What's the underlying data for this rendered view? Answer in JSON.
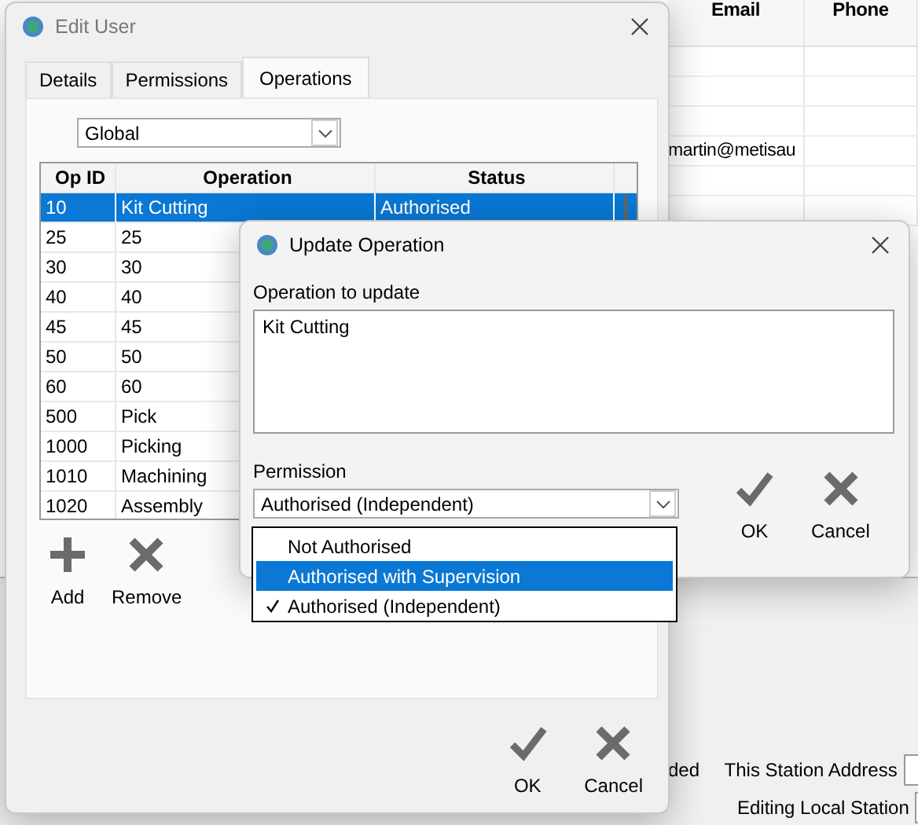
{
  "background_app": {
    "table": {
      "columns": [
        "Email",
        "Phone"
      ],
      "rows": [
        {
          "email": ""
        },
        {
          "email": ""
        },
        {
          "email": ""
        },
        {
          "email": "martin@metisau"
        },
        {
          "email": ""
        },
        {
          "email": ""
        }
      ]
    },
    "footer": {
      "status_fragment": "ded",
      "fields": [
        {
          "label": "This Station Address"
        },
        {
          "label": "Editing Local Station"
        }
      ]
    }
  },
  "edit_user": {
    "title": "Edit User",
    "tabs": [
      {
        "label": "Details",
        "selected": false
      },
      {
        "label": "Permissions",
        "selected": false
      },
      {
        "label": "Operations",
        "selected": true
      }
    ],
    "scope": "Global",
    "table": {
      "columns": [
        "Op ID",
        "Operation",
        "Status"
      ],
      "rows": [
        {
          "op_id": "10",
          "operation": "Kit Cutting",
          "status": "Authorised",
          "selected": true
        },
        {
          "op_id": "25",
          "operation": "25",
          "selected": false
        },
        {
          "op_id": "30",
          "operation": "30",
          "selected": false
        },
        {
          "op_id": "40",
          "operation": "40",
          "selected": false
        },
        {
          "op_id": "45",
          "operation": "45",
          "selected": false
        },
        {
          "op_id": "50",
          "operation": "50",
          "selected": false
        },
        {
          "op_id": "60",
          "operation": "60",
          "selected": false
        },
        {
          "op_id": "500",
          "operation": "Pick",
          "selected": false
        },
        {
          "op_id": "1000",
          "operation": "Picking",
          "selected": false
        },
        {
          "op_id": "1010",
          "operation": "Machining",
          "selected": false
        },
        {
          "op_id": "1020",
          "operation": "Assembly",
          "selected": false
        }
      ]
    },
    "list_buttons": [
      {
        "label": "Add",
        "kind": "add"
      },
      {
        "label": "Remove",
        "kind": "remove"
      }
    ],
    "buttons": [
      {
        "label": "OK",
        "kind": "ok"
      },
      {
        "label": "Cancel",
        "kind": "cancel"
      }
    ]
  },
  "update_operation": {
    "title": "Update Operation",
    "operation_label": "Operation to update",
    "operation_value": "Kit Cutting",
    "permission_label": "Permission",
    "permission_value": "Authorised (Independent)",
    "permission_options": [
      {
        "label": "Not Authorised",
        "selected": false,
        "checked": false
      },
      {
        "label": "Authorised with Supervision",
        "selected": true,
        "checked": false
      },
      {
        "label": "Authorised (Independent)",
        "selected": false,
        "checked": true
      }
    ],
    "buttons": [
      {
        "label": "OK",
        "kind": "ok"
      },
      {
        "label": "Cancel",
        "kind": "cancel"
      }
    ]
  }
}
